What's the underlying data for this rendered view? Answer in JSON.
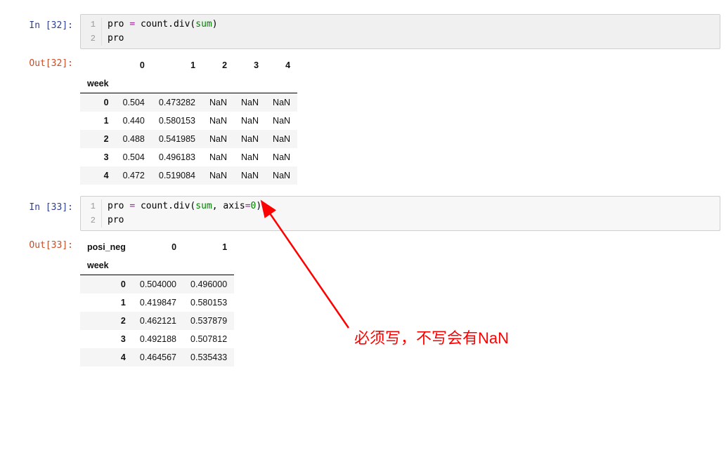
{
  "cells": {
    "c1": {
      "in_label": "In [32]:",
      "out_label": "Out[32]:",
      "line1_gutter": "1",
      "line2_gutter": "2",
      "code_tokens": {
        "t1": "pro ",
        "t2": "= ",
        "t3": "count",
        "t4": ".",
        "t5": "div",
        "t6": "(",
        "t7": "sum",
        "t8": ")"
      },
      "line2": "pro",
      "table": {
        "index_name": "week",
        "columns": [
          "0",
          "1",
          "2",
          "3",
          "4"
        ],
        "rows": [
          {
            "idx": "0",
            "vals": [
              "0.504",
              "0.473282",
              "NaN",
              "NaN",
              "NaN"
            ]
          },
          {
            "idx": "1",
            "vals": [
              "0.440",
              "0.580153",
              "NaN",
              "NaN",
              "NaN"
            ]
          },
          {
            "idx": "2",
            "vals": [
              "0.488",
              "0.541985",
              "NaN",
              "NaN",
              "NaN"
            ]
          },
          {
            "idx": "3",
            "vals": [
              "0.504",
              "0.496183",
              "NaN",
              "NaN",
              "NaN"
            ]
          },
          {
            "idx": "4",
            "vals": [
              "0.472",
              "0.519084",
              "NaN",
              "NaN",
              "NaN"
            ]
          }
        ]
      }
    },
    "c2": {
      "in_label": "In [33]:",
      "out_label": "Out[33]:",
      "line1_gutter": "1",
      "line2_gutter": "2",
      "code_tokens": {
        "t1": "pro ",
        "t2": "= ",
        "t3": "count",
        "t4": ".",
        "t5": "div",
        "t6": "(",
        "t7": "sum",
        "t8": ", axis",
        "t9": "=",
        "t10": "0",
        "t11": ")"
      },
      "line2": "pro",
      "table": {
        "super_index_name": "posi_neg",
        "index_name": "week",
        "columns": [
          "0",
          "1"
        ],
        "rows": [
          {
            "idx": "0",
            "vals": [
              "0.504000",
              "0.496000"
            ]
          },
          {
            "idx": "1",
            "vals": [
              "0.419847",
              "0.580153"
            ]
          },
          {
            "idx": "2",
            "vals": [
              "0.462121",
              "0.537879"
            ]
          },
          {
            "idx": "3",
            "vals": [
              "0.492188",
              "0.507812"
            ]
          },
          {
            "idx": "4",
            "vals": [
              "0.464567",
              "0.535433"
            ]
          }
        ]
      }
    }
  },
  "annotation": "必须写，不写会有NaN"
}
